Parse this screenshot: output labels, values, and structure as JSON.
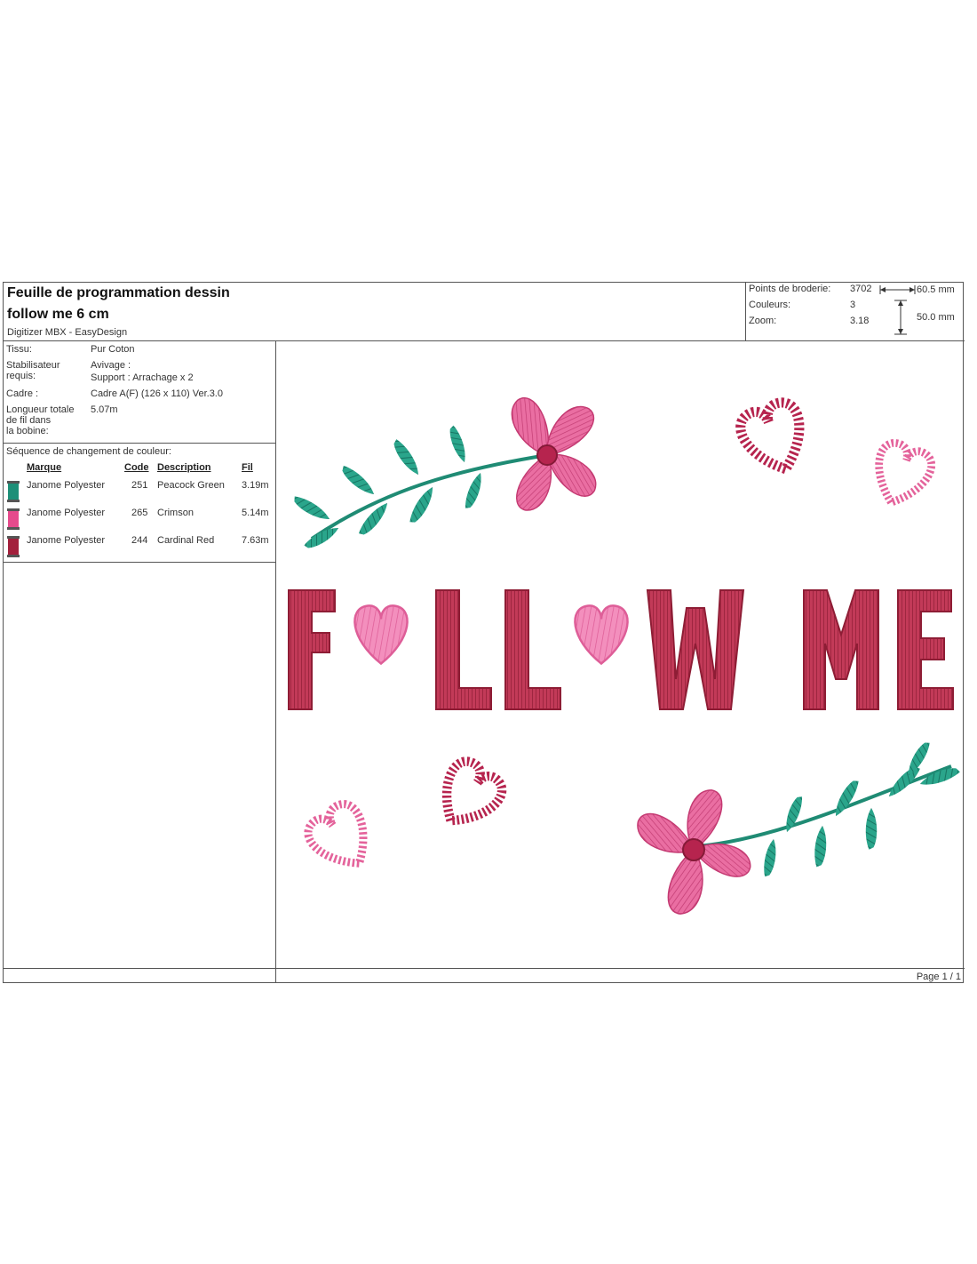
{
  "header": {
    "title": "Feuille de programmation dessin",
    "design_name": "follow me 6 cm",
    "software": "Digitizer MBX - EasyDesign"
  },
  "stats": {
    "stitches_label": "Points de broderie:",
    "stitches_value": "3702",
    "colors_label": "Couleurs:",
    "colors_value": "3",
    "zoom_label": "Zoom:",
    "zoom_value": "3.18",
    "width": "60.5 mm",
    "height": "50.0 mm"
  },
  "info": {
    "fabric_label": "Tissu:",
    "fabric_value": "Pur Coton",
    "stabilizer_label_1": "Stabilisateur",
    "stabilizer_label_2": "requis:",
    "stabilizer_value_1": "Avivage :",
    "stabilizer_value_2": "Support : Arrachage x 2",
    "hoop_label": "Cadre :",
    "hoop_value": "Cadre A(F) (126 x 110) Ver.3.0",
    "length_label_1": "Longueur totale",
    "length_label_2": "de fil dans",
    "length_label_3": "la bobine:",
    "length_value": "5.07m"
  },
  "sequence": {
    "title": "Séquence de changement de couleur:",
    "columns": {
      "brand": "Marque",
      "code": "Code",
      "description": "Description",
      "length": "Fil"
    },
    "rows": [
      {
        "brand": "Janome Polyester",
        "code": "251",
        "description": "Peacock Green",
        "length": "3.19m",
        "color": "#1e8f78"
      },
      {
        "brand": "Janome Polyester",
        "code": "265",
        "description": "Crimson",
        "length": "5.14m",
        "color": "#e64a8c"
      },
      {
        "brand": "Janome Polyester",
        "code": "244",
        "description": "Cardinal Red",
        "length": "7.63m",
        "color": "#a3203c"
      }
    ]
  },
  "colors": {
    "green": "#239a82",
    "pink": "#e0588f",
    "pink_light": "#ef7fb0",
    "red": "#b52a4a",
    "red_dark": "#8e1d35"
  },
  "footer": {
    "page": "Page 1 / 1"
  }
}
